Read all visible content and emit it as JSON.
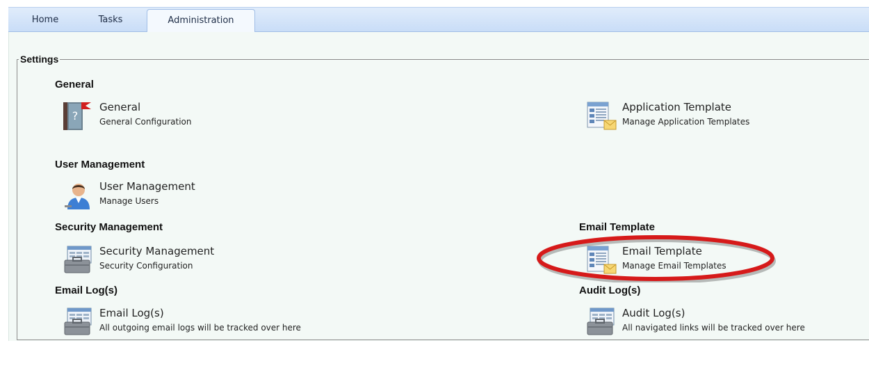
{
  "tabs": {
    "home": "Home",
    "tasks": "Tasks",
    "administration": "Administration"
  },
  "settings": {
    "legend": "Settings",
    "sections": {
      "general": "General",
      "user_management": "User Management",
      "security_management": "Security Management",
      "email_log": "Email Log(s)",
      "email_template": "Email Template",
      "audit_log": "Audit Log(s)"
    },
    "items": {
      "general": {
        "title": "General",
        "desc": "General Configuration",
        "icon": "help-book-icon"
      },
      "application_template": {
        "title": "Application Template",
        "desc": "Manage Application Templates",
        "icon": "template-mail-icon"
      },
      "user_management": {
        "title": "User Management",
        "desc": "Manage Users",
        "icon": "user-icon"
      },
      "security_management": {
        "title": "Security Management",
        "desc": "Security Configuration",
        "icon": "toolbox-window-icon"
      },
      "email_template": {
        "title": "Email Template",
        "desc": "Manage Email Templates",
        "icon": "template-mail-icon"
      },
      "email_log": {
        "title": "Email Log(s)",
        "desc": "All outgoing email logs will be tracked over here",
        "icon": "toolbox-window-icon"
      },
      "audit_log": {
        "title": "Audit Log(s)",
        "desc": "All navigated links will be tracked over here",
        "icon": "toolbox-window-icon"
      }
    }
  },
  "colors": {
    "tabbar": "#c9ddf7",
    "content_bg": "#f3f9f6",
    "highlight": "#d61a1a"
  }
}
